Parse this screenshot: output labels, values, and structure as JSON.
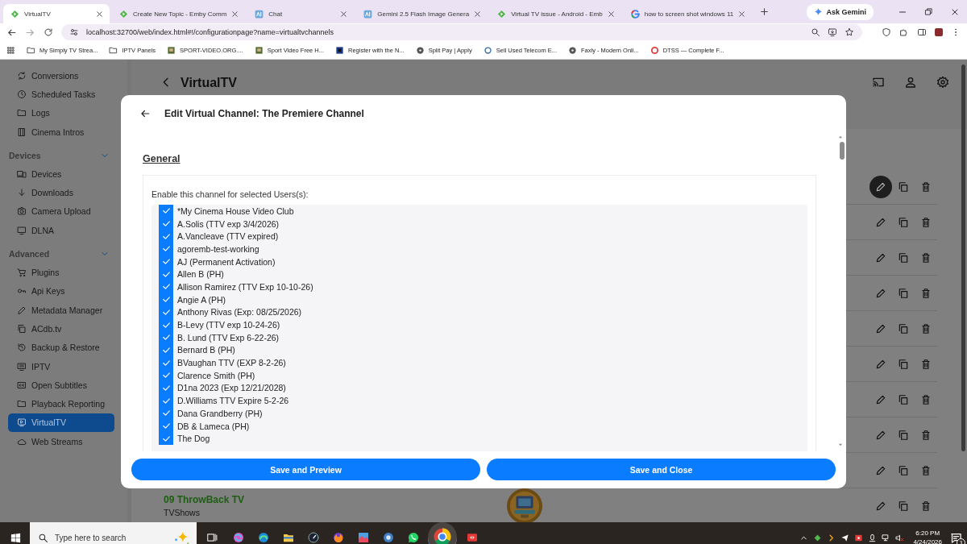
{
  "browser": {
    "tabs": [
      {
        "title": "VirtualTV",
        "selected": true
      },
      {
        "title": "Create New Topic - Emby Comm",
        "selected": false
      },
      {
        "title": "Chat",
        "selected": false
      },
      {
        "title": "Gemini 2.5 Flash Image Genera",
        "selected": false
      },
      {
        "title": "Virtual TV issue - Android - Emb",
        "selected": false
      },
      {
        "title": "how to screen shot windows 11",
        "selected": false
      }
    ],
    "ask_button": "Ask Gemini",
    "url": "localhost:32700/web/index.html#!/configurationpage?name=virtualtvchannels",
    "bookmarks": [
      {
        "label": "My Simply TV Strea..."
      },
      {
        "label": "IPTV Panels"
      },
      {
        "label": "SPORT-VIDEO.ORG...."
      },
      {
        "label": "Sport Video Free H..."
      },
      {
        "label": "Register with the N..."
      },
      {
        "label": "Split Pay | Apply"
      },
      {
        "label": "Sell Used Telecom E..."
      },
      {
        "label": "Faxly - Modern Onli..."
      },
      {
        "label": "DTSS — Complete F..."
      }
    ]
  },
  "sidebar": {
    "groups": [
      {
        "items": [
          {
            "label": "Conversions",
            "selected": false
          },
          {
            "label": "Scheduled Tasks",
            "selected": false
          },
          {
            "label": "Logs",
            "selected": false
          },
          {
            "label": "Cinema Intros",
            "selected": false
          }
        ]
      },
      {
        "header": "Devices",
        "expanded": true,
        "items": [
          {
            "label": "Devices",
            "selected": false
          },
          {
            "label": "Downloads",
            "selected": false
          },
          {
            "label": "Camera Upload",
            "selected": false
          },
          {
            "label": "DLNA",
            "selected": false
          }
        ]
      },
      {
        "header": "Advanced",
        "expanded": true,
        "items": [
          {
            "label": "Plugins",
            "selected": false
          },
          {
            "label": "Api Keys",
            "selected": false
          },
          {
            "label": "Metadata Manager",
            "selected": false
          },
          {
            "label": "ACdb.tv",
            "selected": false
          },
          {
            "label": "Backup & Restore",
            "selected": false
          },
          {
            "label": "IPTV",
            "selected": false
          },
          {
            "label": "Open Subtitles",
            "selected": false
          },
          {
            "label": "Playback Reporting",
            "selected": false
          },
          {
            "label": "VirtualTV",
            "selected": true
          },
          {
            "label": "Web Streams",
            "selected": false
          }
        ]
      }
    ]
  },
  "page": {
    "title": "VirtualTV",
    "channel_rows": [
      {
        "focused": true
      },
      {
        "focused": false
      },
      {
        "focused": false
      },
      {
        "focused": false
      },
      {
        "focused": false
      },
      {
        "focused": false
      },
      {
        "focused": false
      },
      {
        "focused": false
      },
      {
        "focused": false
      },
      {
        "focused": false,
        "name": "09 ThrowBack TV",
        "type": "TVShows"
      }
    ]
  },
  "dialog": {
    "title": "Edit Virtual Channel: The Premiere Channel",
    "section": "General",
    "users_label": "Enable this channel for selected Users(s):",
    "users": [
      {
        "name": "*My Cinema House Video Club",
        "checked": true
      },
      {
        "name": "A.Solis (TTV exp 3/4/2026)",
        "checked": true
      },
      {
        "name": "A.Vancleave (TTV expired)",
        "checked": true
      },
      {
        "name": "agoremb-test-working",
        "checked": true
      },
      {
        "name": "AJ (Permanent Activation)",
        "checked": true
      },
      {
        "name": "Allen B (PH)",
        "checked": true
      },
      {
        "name": "Allison Ramirez (TTV Exp 10-10-26)",
        "checked": true
      },
      {
        "name": "Angie A (PH)",
        "checked": true
      },
      {
        "name": "Anthony Rivas (Exp: 08/25/2026)",
        "checked": true
      },
      {
        "name": "B-Levy (TTV exp 10-24-26)",
        "checked": true
      },
      {
        "name": "B. Lund (TTV Exp 6-22-26)",
        "checked": true
      },
      {
        "name": "Bernard B (PH)",
        "checked": true
      },
      {
        "name": "BVaughan TTV (EXP 8-2-26)",
        "checked": true
      },
      {
        "name": "Clarence Smith (PH)",
        "checked": true
      },
      {
        "name": "D1na 2023 (Exp 12/21/2028)",
        "checked": true
      },
      {
        "name": "D.Williams TTV Expire 5-2-26",
        "checked": true
      },
      {
        "name": "Dana Grandberry (PH)",
        "checked": true
      },
      {
        "name": "DB & Lameca (PH)",
        "checked": true
      },
      {
        "name": "The Dog",
        "checked": true
      }
    ],
    "buttons": [
      {
        "label": "Save and Preview"
      },
      {
        "label": "Save and Close"
      }
    ]
  },
  "taskbar": {
    "search_placeholder": "Type here to search",
    "time": "6:20 PM",
    "date": "4/24/2026",
    "notification_count": "3"
  }
}
